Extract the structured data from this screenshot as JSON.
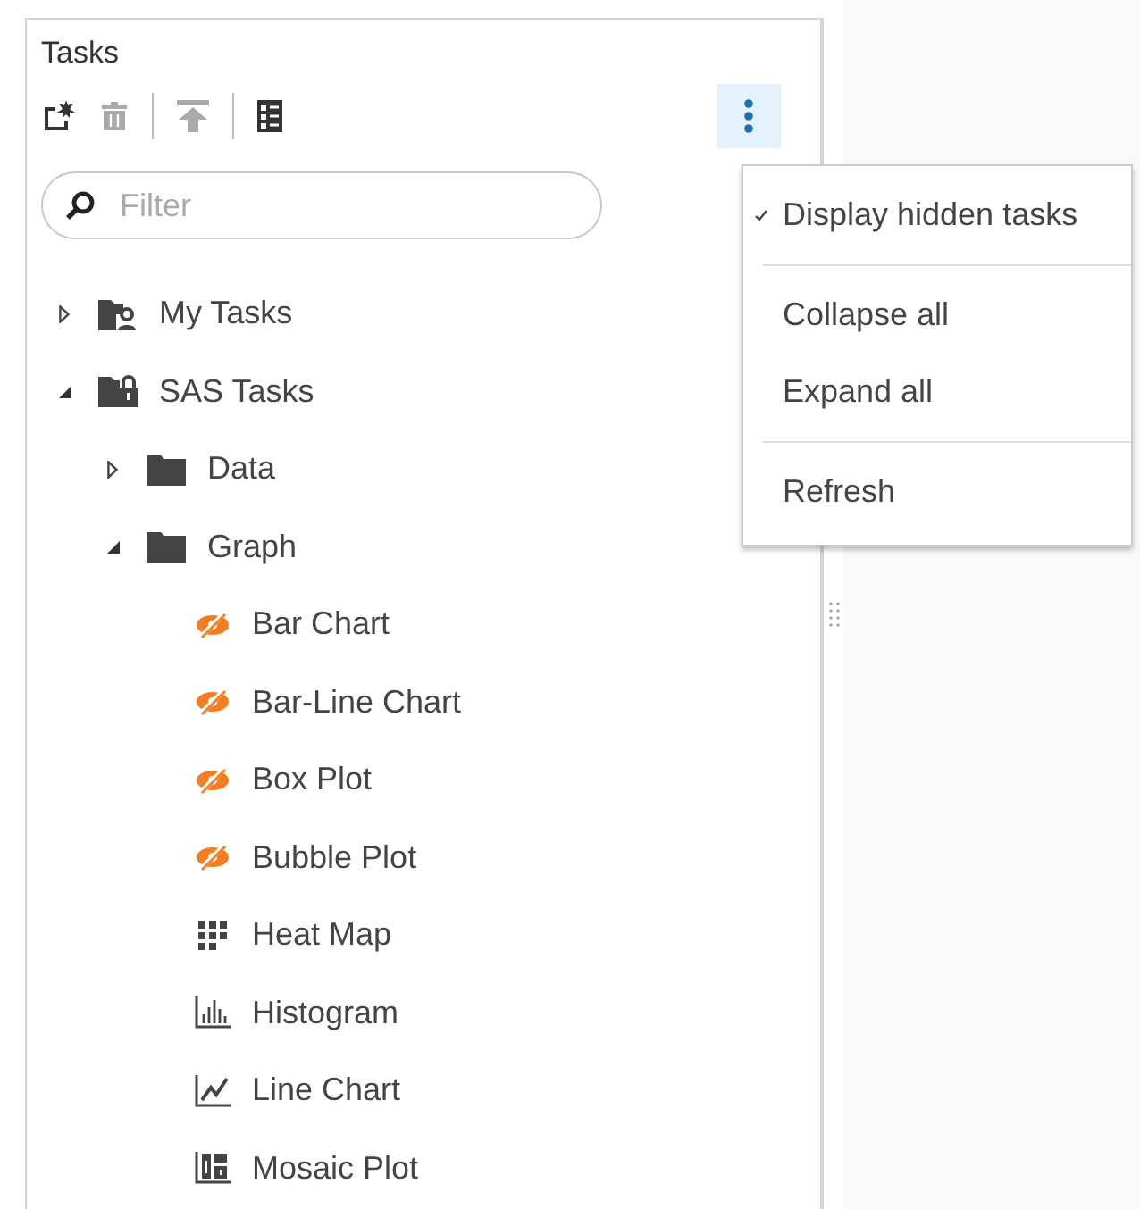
{
  "panel": {
    "title": "Tasks"
  },
  "toolbar": [
    {
      "kind": "new",
      "disabled": false
    },
    {
      "kind": "delete",
      "disabled": true
    },
    {
      "kind": "upload",
      "disabled": true
    },
    {
      "kind": "details",
      "disabled": false
    }
  ],
  "more_button": {
    "expanded": true
  },
  "filter": {
    "placeholder": "Filter"
  },
  "tree": [
    {
      "label": "My Tasks",
      "kind": "user-folder",
      "expanded": false
    },
    {
      "label": "SAS Tasks",
      "kind": "locked-folder",
      "expanded": true,
      "children": [
        {
          "label": "Data",
          "kind": "folder",
          "expanded": false
        },
        {
          "label": "Graph",
          "kind": "folder",
          "expanded": true,
          "children": [
            {
              "label": "Bar Chart",
              "kind": "hidden-task"
            },
            {
              "label": "Bar-Line Chart",
              "kind": "hidden-task"
            },
            {
              "label": "Box Plot",
              "kind": "hidden-task"
            },
            {
              "label": "Bubble Plot",
              "kind": "hidden-task"
            },
            {
              "label": "Heat Map",
              "kind": "heat-map"
            },
            {
              "label": "Histogram",
              "kind": "histogram"
            },
            {
              "label": "Line Chart",
              "kind": "line-chart"
            },
            {
              "label": "Mosaic Plot",
              "kind": "mosaic-plot"
            }
          ]
        }
      ]
    }
  ],
  "menu": [
    [
      {
        "label": "Display hidden tasks",
        "checked": true
      }
    ],
    [
      {
        "label": "Collapse all",
        "checked": false
      },
      {
        "label": "Expand all",
        "checked": false
      }
    ],
    [
      {
        "label": "Refresh",
        "checked": false
      }
    ]
  ]
}
